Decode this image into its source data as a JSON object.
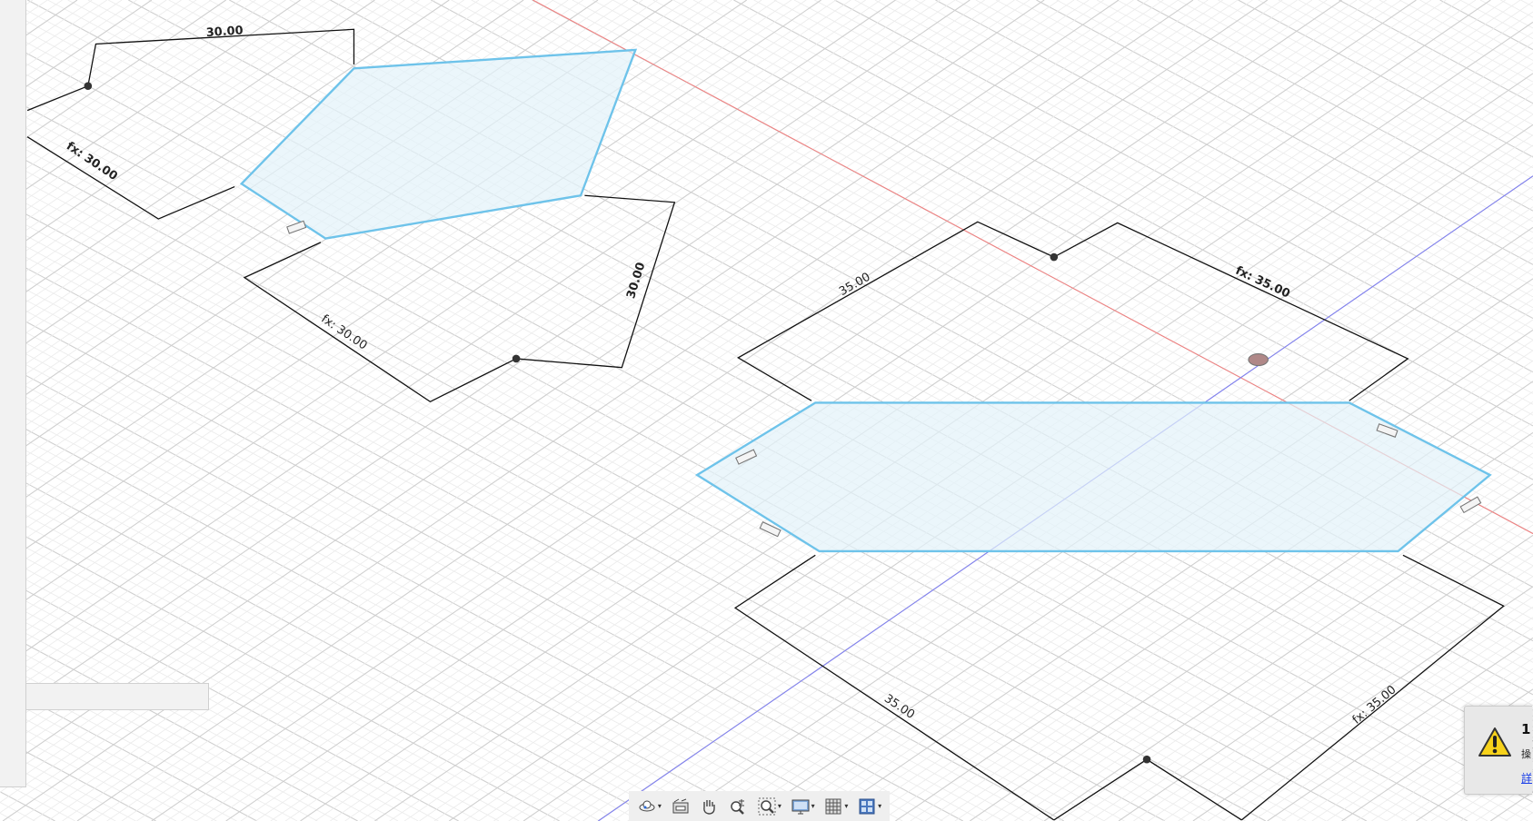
{
  "colors": {
    "profile_stroke": "#6ec3ea",
    "profile_fill": "#e8f5fb",
    "x_axis": "#f08080",
    "y_axis": "#8080f0",
    "dimension": "#111111"
  },
  "sketch": {
    "dimensions": [
      {
        "id": "d1",
        "label": "30.00",
        "bold": true
      },
      {
        "id": "d2",
        "label": "fx: 30.00",
        "bold": true
      },
      {
        "id": "d3",
        "label": "fx: 30.00",
        "bold": false
      },
      {
        "id": "d4",
        "label": "30.00",
        "bold": true
      },
      {
        "id": "d5",
        "label": "35.00",
        "bold": false
      },
      {
        "id": "d6",
        "label": "fx: 35.00",
        "bold": true
      },
      {
        "id": "d7",
        "label": "35.00",
        "bold": false
      },
      {
        "id": "d8",
        "label": "fx: 35.00",
        "bold": false
      }
    ]
  },
  "toolbar": {
    "items": [
      {
        "name": "orbit",
        "icon": "orbit-icon",
        "dropdown": true
      },
      {
        "name": "look-at",
        "icon": "look-at-icon",
        "dropdown": false
      },
      {
        "name": "pan",
        "icon": "hand-icon",
        "dropdown": false
      },
      {
        "name": "zoom",
        "icon": "zoom-icon",
        "dropdown": false
      },
      {
        "name": "fit",
        "icon": "zoom-window-icon",
        "dropdown": true
      },
      {
        "name": "display-settings",
        "icon": "monitor-icon",
        "dropdown": true
      },
      {
        "name": "grid-snaps",
        "icon": "grid-icon",
        "dropdown": true
      },
      {
        "name": "viewports",
        "icon": "viewports-icon",
        "dropdown": true
      }
    ],
    "caret": "▾"
  },
  "warning": {
    "count": "1",
    "message": "操",
    "link": "詳"
  }
}
